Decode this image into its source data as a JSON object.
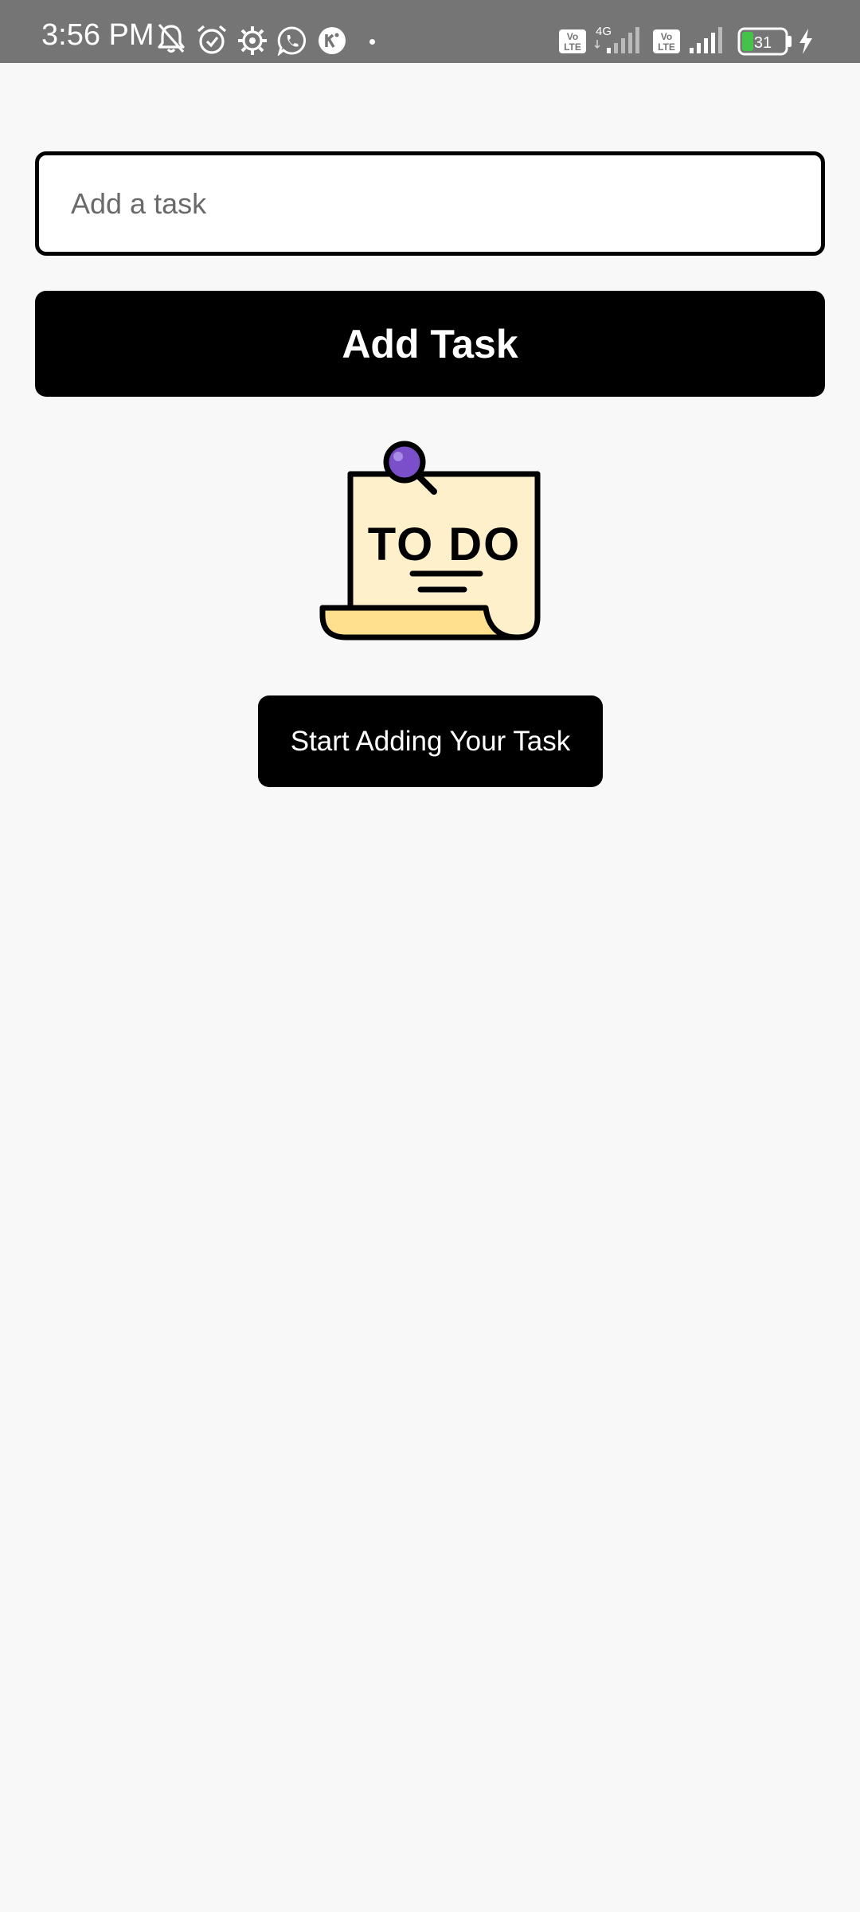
{
  "status_bar": {
    "time": "3:56 PM",
    "network_type": "4G",
    "volte_label_top": "Vo",
    "volte_label_bottom": "LTE",
    "battery_level": "31",
    "icons": [
      "bell-off-icon",
      "alarm-icon",
      "gear-icon",
      "whatsapp-icon",
      "chat-app-icon",
      "dot-icon",
      "volte-icon",
      "signal-icon",
      "battery-icon",
      "charging-icon"
    ]
  },
  "task_input": {
    "placeholder": "Add a task",
    "value": ""
  },
  "add_task_button": {
    "label": "Add Task"
  },
  "illustration": {
    "text": "TO DO",
    "icon": "todo-note-icon"
  },
  "empty_state": {
    "label": "Start Adding Your Task"
  },
  "colors": {
    "status_bar": "#757575",
    "background": "#f8f8f8",
    "button": "#000000",
    "button_text": "#ffffff",
    "note_paper": "#fff0cc",
    "note_fold": "#ffe08f",
    "pin": "#7a4fc9",
    "battery_fill": "#44c24a"
  }
}
